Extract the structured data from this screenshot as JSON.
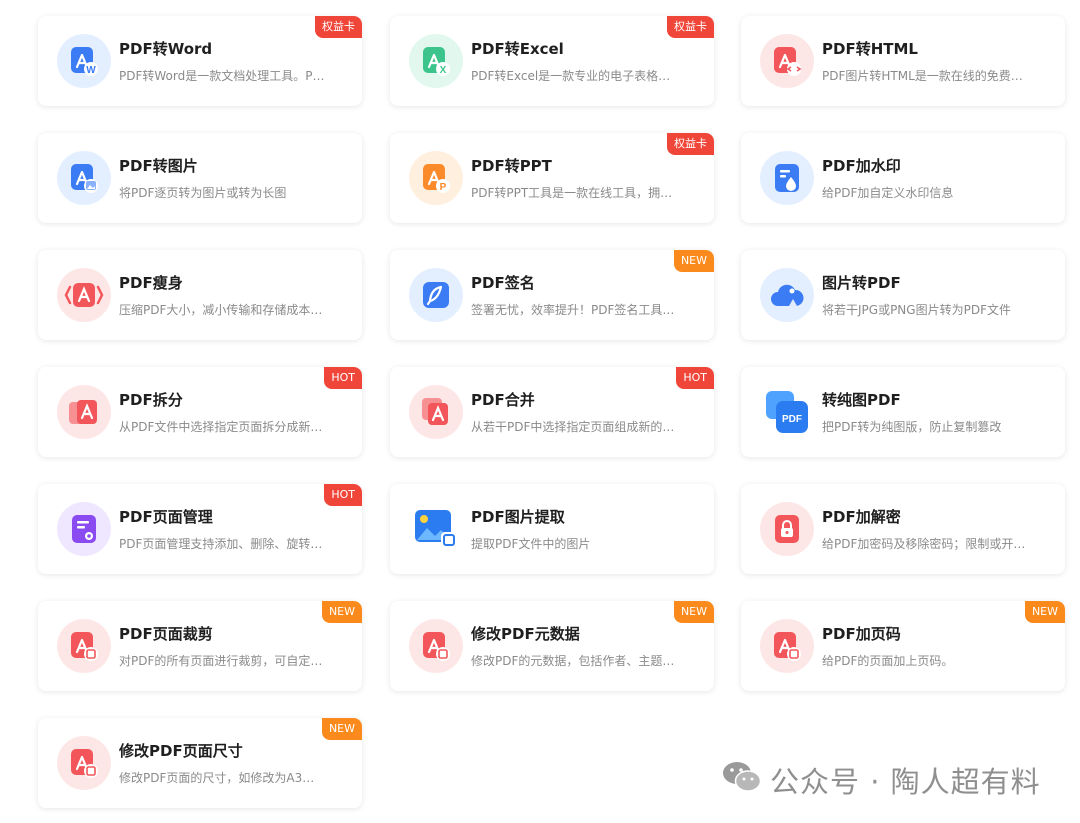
{
  "tools": [
    {
      "title": "PDF转Word",
      "desc": "PDF转Word是一款文档处理工具。P…",
      "badge": "权益卡",
      "badge_color": "red",
      "icon": "word-icon",
      "color": "#3b7cf5",
      "bg": "#e3efff",
      "glyph": "W"
    },
    {
      "title": "PDF转Excel",
      "desc": "PDF转Excel是一款专业的电子表格…",
      "badge": "权益卡",
      "badge_color": "red",
      "icon": "excel-icon",
      "color": "#3cc48c",
      "bg": "#e2f8ee",
      "glyph": "X"
    },
    {
      "title": "PDF转HTML",
      "desc": "PDF图片转HTML是一款在线的免费…",
      "badge": "",
      "badge_color": "",
      "icon": "html-icon",
      "color": "#f3565a",
      "bg": "#fde7e6",
      "glyph": "code"
    },
    {
      "title": "PDF转图片",
      "desc": "将PDF逐页转为图片或转为长图",
      "badge": "",
      "badge_color": "",
      "icon": "image-convert-icon",
      "color": "#3b7cf5",
      "bg": "#e3efff",
      "glyph": "img"
    },
    {
      "title": "PDF转PPT",
      "desc": "PDF转PPT工具是一款在线工具，拥…",
      "badge": "权益卡",
      "badge_color": "red",
      "icon": "ppt-icon",
      "color": "#fb8a2a",
      "bg": "#ffefdf",
      "glyph": "P"
    },
    {
      "title": "PDF加水印",
      "desc": "给PDF加自定义水印信息",
      "badge": "",
      "badge_color": "",
      "icon": "watermark-drop-icon",
      "color": "#3b7cf5",
      "bg": "#e3efff",
      "glyph": "drop"
    },
    {
      "title": "PDF瘦身",
      "desc": "压缩PDF大小，减小传输和存储成本…",
      "badge": "",
      "badge_color": "",
      "icon": "compress-icon",
      "color": "#f3565a",
      "bg": "#fde7e6",
      "glyph": "compress"
    },
    {
      "title": "PDF签名",
      "desc": "签署无忧，效率提升！PDF签名工具…",
      "badge": "NEW",
      "badge_color": "orange",
      "icon": "feather-pen-icon",
      "color": "#3b7cf5",
      "bg": "#e3efff",
      "glyph": "feather"
    },
    {
      "title": "图片转PDF",
      "desc": "将若干JPG或PNG图片转为PDF文件",
      "badge": "",
      "badge_color": "",
      "icon": "cloud-image-icon",
      "color": "#3b7cf5",
      "bg": "#e3efff",
      "glyph": "cloud"
    },
    {
      "title": "PDF拆分",
      "desc": "从PDF文件中选择指定页面拆分成新…",
      "badge": "HOT",
      "badge_color": "red",
      "icon": "split-icon",
      "color": "#f3565a",
      "bg": "#fde7e6",
      "glyph": "split"
    },
    {
      "title": "PDF合并",
      "desc": "从若干PDF中选择指定页面组成新的…",
      "badge": "HOT",
      "badge_color": "red",
      "icon": "merge-icon",
      "color": "#f3565a",
      "bg": "#fde7e6",
      "glyph": "merge"
    },
    {
      "title": "转纯图PDF",
      "desc": "把PDF转为纯图版，防止复制篡改",
      "badge": "",
      "badge_color": "",
      "icon": "pure-image-pdf-icon",
      "color": "#2a7cf0",
      "bg": "none",
      "glyph": "pdfbox",
      "glyph_text": "PDF"
    },
    {
      "title": "PDF页面管理",
      "desc": "PDF页面管理支持添加、删除、旋转…",
      "badge": "HOT",
      "badge_color": "red",
      "icon": "page-manage-icon",
      "color": "#8a4cf0",
      "bg": "#efe7ff",
      "glyph": "manage"
    },
    {
      "title": "PDF图片提取",
      "desc": "提取PDF文件中的图片",
      "badge": "",
      "badge_color": "",
      "icon": "image-extract-icon",
      "color": "#2a7cf0",
      "bg": "none",
      "glyph": "extract"
    },
    {
      "title": "PDF加解密",
      "desc": "给PDF加密码及移除密码；限制或开…",
      "badge": "",
      "badge_color": "",
      "icon": "lock-icon",
      "color": "#f3565a",
      "bg": "#fde7e6",
      "glyph": "lock"
    },
    {
      "title": "PDF页面裁剪",
      "desc": "对PDF的所有页面进行裁剪，可自定…",
      "badge": "NEW",
      "badge_color": "orange",
      "icon": "crop-icon",
      "color": "#f3565a",
      "bg": "#fde7e6",
      "glyph": "crop"
    },
    {
      "title": "修改PDF元数据",
      "desc": "修改PDF的元数据，包括作者、主题…",
      "badge": "NEW",
      "badge_color": "orange",
      "icon": "metadata-icon",
      "color": "#f3565a",
      "bg": "#fde7e6",
      "glyph": "meta"
    },
    {
      "title": "PDF加页码",
      "desc": "给PDF的页面加上页码。",
      "badge": "NEW",
      "badge_color": "orange",
      "icon": "page-number-icon",
      "color": "#f3565a",
      "bg": "#fde7e6",
      "glyph": "pagenum"
    },
    {
      "title": "修改PDF页面尺寸",
      "desc": "修改PDF页面的尺寸，如修改为A3…",
      "badge": "NEW",
      "badge_color": "orange",
      "icon": "resize-icon",
      "color": "#f3565a",
      "bg": "#fde7e6",
      "glyph": "resize"
    }
  ],
  "watermark": {
    "text": "公众号 · 陶人超有料",
    "icon": "wechat-icon"
  }
}
